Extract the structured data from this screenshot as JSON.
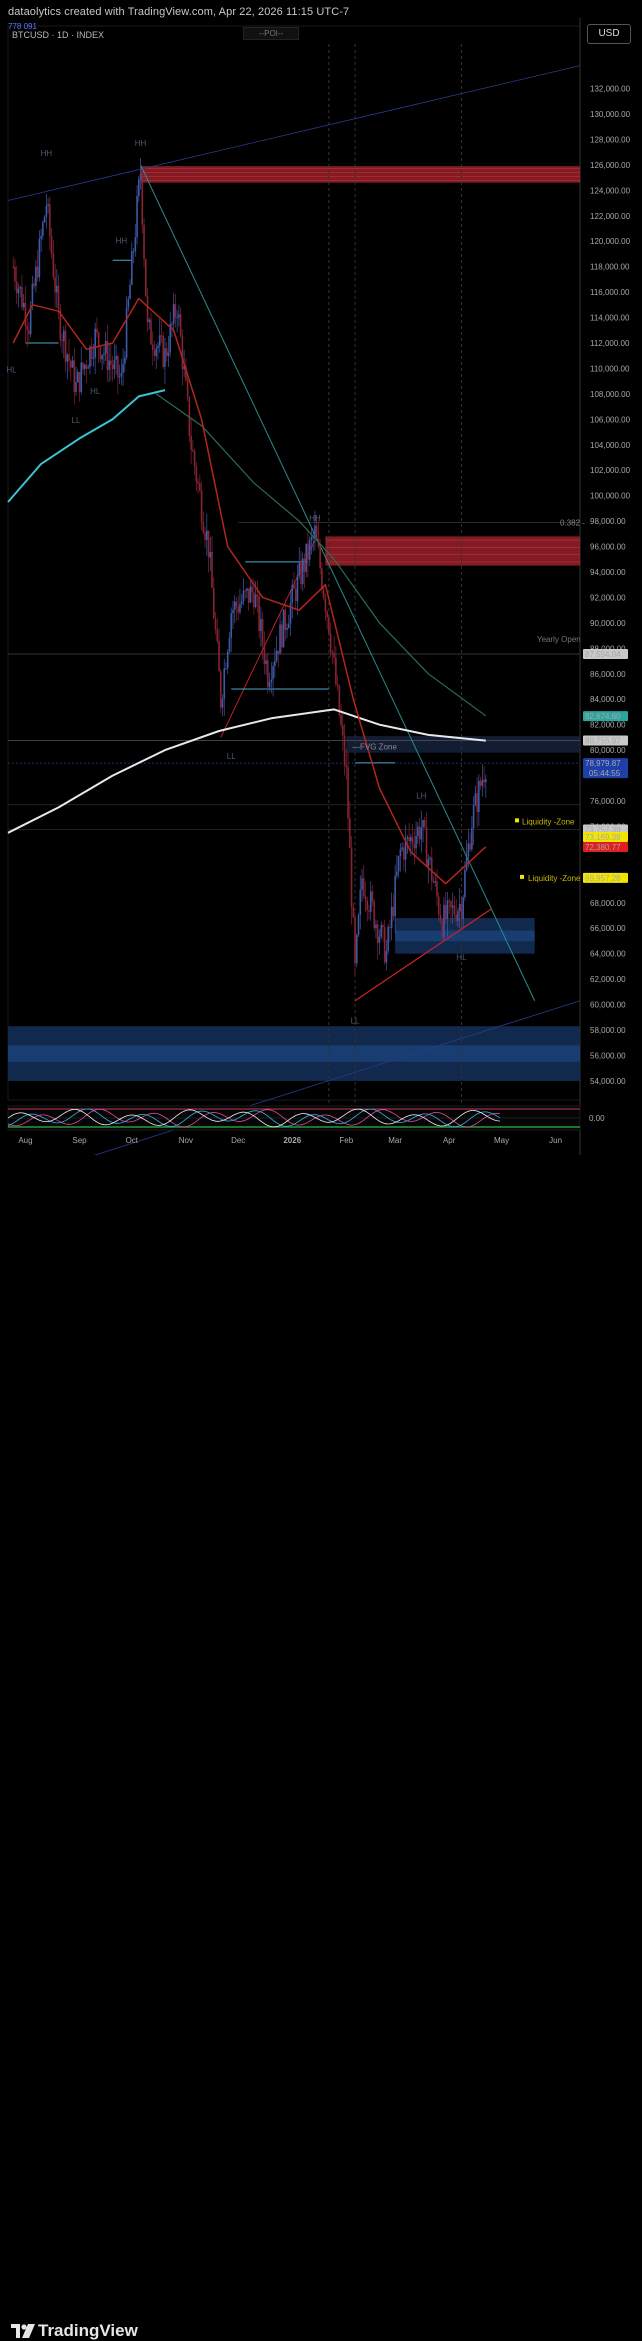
{
  "header": {
    "title": "dataolytics created with TradingView.com, Apr 22, 2026 11:15 UTC-7",
    "symbol": "BTCUSD · 1D · INDEX",
    "badge": "778 091",
    "poi_label": "--POI--",
    "currency_button": "USD"
  },
  "colors": {
    "background": "#000000",
    "candle": "#8a2433",
    "ema_fast": "#b3261e",
    "ema_mid": "#2f6b55",
    "ema_cyan": "#39c4d6",
    "ema_white": "#e8e8e8",
    "supply_zone": "#b0242f",
    "demand_zone": "#14305a",
    "trendline_teal": "#2a8c8c",
    "trendline_red": "#d0202a",
    "fvg_zone": "#1a2a4a"
  },
  "annotations": {
    "fib_label": "0.382 -",
    "yearly_open": "Yearly Open",
    "fvg_zone": "---FVG Zone",
    "liquidity_zone_1": "Liquidity -Zone",
    "liquidity_zone_2": "Liquidity -Zone",
    "swing_labels": [
      "HH",
      "HH",
      "HH",
      "HL",
      "HL",
      "LL",
      "LL",
      "HH",
      "HL",
      "LL",
      "LH"
    ]
  },
  "price_badges": [
    {
      "text": "87,554.04",
      "bg": "#c8c8c8",
      "fg": "#111",
      "value": 87554.04
    },
    {
      "text": "82,674.60",
      "bg": "#2aa5a0",
      "fg": "#fff",
      "value": 82674.6
    },
    {
      "text": "80,755.97",
      "bg": "#c8c8c8",
      "fg": "#111",
      "value": 80755.97
    },
    {
      "text": "78,979.87",
      "bg": "#1e3fa8",
      "fg": "#fff",
      "value": 78979.87,
      "sub": "05:44:55"
    },
    {
      "text": "73,757.39",
      "bg": "#c8c8c8",
      "fg": "#111",
      "value": 73757.39
    },
    {
      "text": "73,169.38",
      "bg": "#f2e600",
      "fg": "#111",
      "value": 73169.38
    },
    {
      "text": "72,380.77",
      "bg": "#e01e1e",
      "fg": "#fff",
      "value": 72380.77
    },
    {
      "text": "69,957.28",
      "bg": "#f2e600",
      "fg": "#111",
      "value": 69957.28
    }
  ],
  "oscillator": {
    "zero_label": "0.00"
  },
  "footer": {
    "brand": "TradingView"
  },
  "chart_data": {
    "type": "candlestick",
    "title": "",
    "symbol": "BTCUSD",
    "timeframe": "1D",
    "ylim": [
      52500,
      135500
    ],
    "y_ticks": [
      "132,000.00",
      "130,000.00",
      "128,000.00",
      "126,000.00",
      "124,000.00",
      "122,000.00",
      "120,000.00",
      "118,000.00",
      "116,000.00",
      "114,000.00",
      "112,000.00",
      "110,000.00",
      "108,000.00",
      "106,000.00",
      "104,000.00",
      "102,000.00",
      "100,000.00",
      "98,000.00",
      "96,000.00",
      "94,000.00",
      "92,000.00",
      "90,000.00",
      "88,000.00",
      "86,000.00",
      "84,000.00",
      "82,000.00",
      "80,000.00",
      "76,000.00",
      "74,000.00",
      "70,000.00",
      "68,000.00",
      "66,000.00",
      "64,000.00",
      "62,000.00",
      "60,000.00",
      "58,000.00",
      "56,000.00",
      "54,000.00"
    ],
    "x_labels": [
      "Aug",
      "Sep",
      "Oct",
      "Nov",
      "Dec",
      "2026",
      "Feb",
      "Mar",
      "Apr",
      "May",
      "Jun"
    ],
    "x_range": [
      "2025-07-22",
      "2026-06-15"
    ],
    "price_path": [
      [
        "2025-07-25",
        118000
      ],
      [
        "2025-08-03",
        113500
      ],
      [
        "2025-08-13",
        123000
      ],
      [
        "2025-08-20",
        114000
      ],
      [
        "2025-08-30",
        108500
      ],
      [
        "2025-09-10",
        112500
      ],
      [
        "2025-09-25",
        109000
      ],
      [
        "2025-10-06",
        125500
      ],
      [
        "2025-10-10",
        113000
      ],
      [
        "2025-10-20",
        111000
      ],
      [
        "2025-10-27",
        115000
      ],
      [
        "2025-11-04",
        104000
      ],
      [
        "2025-11-14",
        96000
      ],
      [
        "2025-11-21",
        84000
      ],
      [
        "2025-11-27",
        91000
      ],
      [
        "2025-12-10",
        92500
      ],
      [
        "2025-12-18",
        86000
      ],
      [
        "2026-01-05",
        93500
      ],
      [
        "2026-01-14",
        97000
      ],
      [
        "2026-01-22",
        90000
      ],
      [
        "2026-02-01",
        78000
      ],
      [
        "2026-02-06",
        62500
      ],
      [
        "2026-02-10",
        70000
      ],
      [
        "2026-02-24",
        64000
      ],
      [
        "2026-03-04",
        72000
      ],
      [
        "2026-03-16",
        74000
      ],
      [
        "2026-03-28",
        66500
      ],
      [
        "2026-04-08",
        68000
      ],
      [
        "2026-04-14",
        74500
      ],
      [
        "2026-04-22",
        78980
      ]
    ],
    "ema_fast": [
      [
        "2025-07-25",
        112000
      ],
      [
        "2025-08-05",
        115000
      ],
      [
        "2025-08-20",
        114500
      ],
      [
        "2025-09-05",
        111500
      ],
      [
        "2025-09-20",
        112000
      ],
      [
        "2025-10-05",
        115500
      ],
      [
        "2025-10-25",
        113000
      ],
      [
        "2025-11-10",
        106000
      ],
      [
        "2025-11-25",
        96000
      ],
      [
        "2025-12-15",
        92000
      ],
      [
        "2026-01-05",
        91000
      ],
      [
        "2026-01-20",
        93000
      ],
      [
        "2026-02-05",
        84000
      ],
      [
        "2026-02-20",
        77000
      ],
      [
        "2026-03-10",
        72000
      ],
      [
        "2026-03-30",
        69500
      ],
      [
        "2026-04-22",
        72400
      ]
    ],
    "ema_mid": [
      [
        "2025-10-15",
        108000
      ],
      [
        "2025-11-10",
        105500
      ],
      [
        "2025-12-10",
        101000
      ],
      [
        "2026-01-05",
        98000
      ],
      [
        "2026-01-25",
        95000
      ],
      [
        "2026-02-20",
        90000
      ],
      [
        "2026-03-20",
        86000
      ],
      [
        "2026-04-22",
        82700
      ]
    ],
    "ema_cyan": [
      [
        "2025-07-22",
        99500
      ],
      [
        "2025-08-10",
        102500
      ],
      [
        "2025-09-01",
        104500
      ],
      [
        "2025-09-20",
        106000
      ],
      [
        "2025-10-05",
        107800
      ],
      [
        "2025-10-20",
        108300
      ]
    ],
    "ema_white": [
      [
        "2025-07-22",
        73500
      ],
      [
        "2025-08-20",
        75500
      ],
      [
        "2025-09-20",
        78000
      ],
      [
        "2025-10-20",
        80000
      ],
      [
        "2025-11-20",
        81500
      ],
      [
        "2025-12-20",
        82500
      ],
      [
        "2026-01-25",
        83200
      ],
      [
        "2026-02-20",
        82000
      ],
      [
        "2026-03-20",
        81200
      ],
      [
        "2026-04-22",
        80750
      ]
    ],
    "zones": [
      {
        "type": "supply",
        "y0": 124600,
        "y1": 125900,
        "x0": "2025-10-06",
        "x1": "2026-06-15"
      },
      {
        "type": "supply",
        "y0": 94500,
        "y1": 96800,
        "x0": "2026-01-20",
        "x1": "2026-06-15"
      },
      {
        "type": "demand",
        "y0": 54000,
        "y1": 58300,
        "x0": "2025-07-22",
        "x1": "2026-06-15"
      },
      {
        "type": "demand",
        "y0": 64000,
        "y1": 66800,
        "x0": "2026-03-01",
        "x1": "2026-05-20"
      }
    ],
    "grid": false,
    "legend": "none"
  }
}
